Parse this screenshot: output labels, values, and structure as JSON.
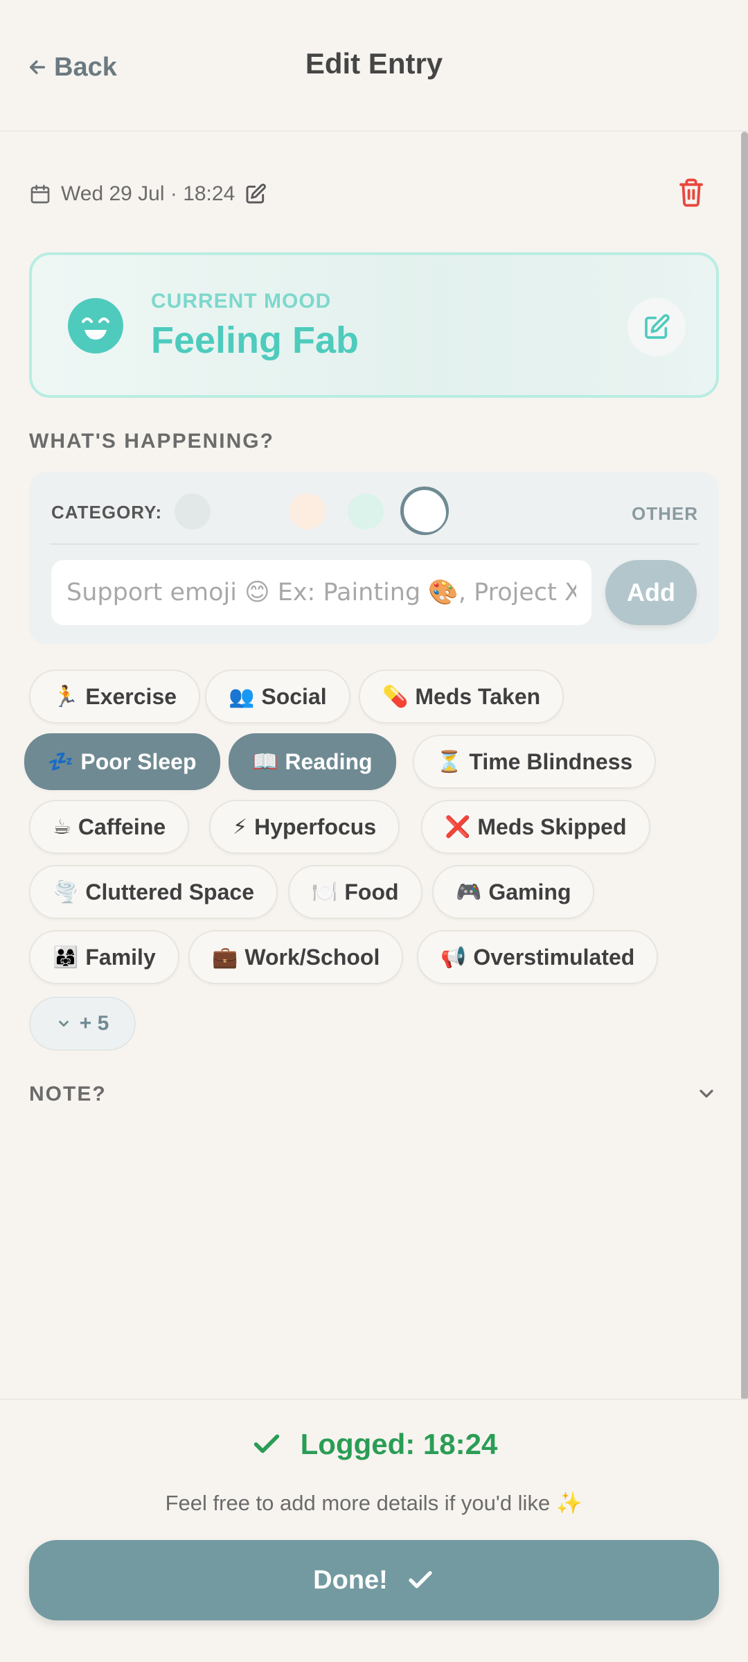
{
  "header": {
    "back_label": "Back",
    "title": "Edit Entry"
  },
  "entry": {
    "datetime": "Wed 29 Jul · 18:24",
    "calendar_icon": "calendar-icon",
    "edit_icon": "pencil-icon",
    "delete_icon": "trash-icon",
    "delete_color": "#e9473e"
  },
  "mood": {
    "eyebrow": "CURRENT MOOD",
    "name": "Feeling Fab",
    "face_icon": "smiling-face-icon",
    "edit_icon": "pencil-icon",
    "accent": "#4ecbbd"
  },
  "whats_happening": {
    "label": "WHAT'S HAPPENING?",
    "category_label": "CATEGORY:",
    "category_colors": [
      "#e1e8e7",
      "#fdece0",
      "#dcf3ec",
      "#ffffff"
    ],
    "selected_category": 4,
    "other_label": "OTHER",
    "input_placeholder": "Support emoji 😊 Ex: Painting 🎨, Project X 🚀",
    "add_label": "Add"
  },
  "tags": [
    {
      "emoji": "🏃",
      "label": "Exercise",
      "selected": false
    },
    {
      "emoji": "👥",
      "label": "Social",
      "selected": false
    },
    {
      "emoji": "💊",
      "label": "Meds Taken",
      "selected": false
    },
    {
      "emoji": "💤",
      "label": "Poor Sleep",
      "selected": true
    },
    {
      "emoji": "📖",
      "label": "Reading",
      "selected": true
    },
    {
      "emoji": "⏳",
      "label": "Time Blindness",
      "selected": false
    },
    {
      "emoji": "☕",
      "label": "Caffeine",
      "selected": false
    },
    {
      "emoji": "⚡",
      "label": "Hyperfocus",
      "selected": false
    },
    {
      "emoji": "❌",
      "label": "Meds Skipped",
      "selected": false
    },
    {
      "emoji": "🌪️",
      "label": "Cluttered Space",
      "selected": false
    },
    {
      "emoji": "🍽️",
      "label": "Food",
      "selected": false
    },
    {
      "emoji": "🎮",
      "label": "Gaming",
      "selected": false
    },
    {
      "emoji": "👨‍👩‍👧",
      "label": "Family",
      "selected": false
    },
    {
      "emoji": "💼",
      "label": "Work/School",
      "selected": false
    },
    {
      "emoji": "📢",
      "label": "Overstimulated",
      "selected": false
    }
  ],
  "more_tags": "+ 5",
  "note": {
    "label": "NOTE?"
  },
  "footer": {
    "logged_text": "Logged: 18:24",
    "hint": "Feel free to add more details if you'd like ✨",
    "done_label": "Done!",
    "success_color": "#2a9d55",
    "button_color": "#739aa1"
  }
}
